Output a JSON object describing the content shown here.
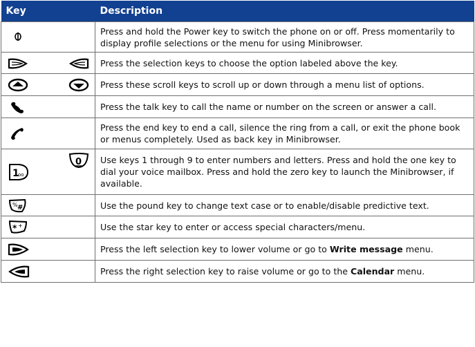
{
  "table": {
    "headers": {
      "key": "Key",
      "description": "Description"
    },
    "rows": [
      {
        "icons": [
          "power-key-icon"
        ],
        "segments": [
          {
            "text": "Press and hold the Power key to switch the phone on or off. Press momentarily to display profile selections or the menu for using Minibrowser."
          }
        ]
      },
      {
        "icons": [
          "left-selection-key-icon",
          "right-selection-key-icon"
        ],
        "segments": [
          {
            "text": "Press the selection keys to choose the option labeled above the key."
          }
        ]
      },
      {
        "icons": [
          "scroll-up-key-icon",
          "scroll-down-key-icon"
        ],
        "segments": [
          {
            "text": "Press these scroll keys to scroll up or down through a menu list of options."
          }
        ]
      },
      {
        "icons": [
          "talk-key-icon"
        ],
        "segments": [
          {
            "text": "Press the talk key to call the name or number on the screen or answer a call."
          }
        ]
      },
      {
        "icons": [
          "end-key-icon"
        ],
        "segments": [
          {
            "text": "Press the end key to end a call, silence the ring from a call, or exit the phone book or menus completely. Used as back key in Minibrowser."
          }
        ]
      },
      {
        "icons": [
          "one-key-icon",
          "zero-key-icon"
        ],
        "segments": [
          {
            "text": "Use keys 1 through 9 to enter numbers and letters. Press and hold the one key to dial your voice mailbox. Press and hold the zero key to launch the Minibrowser, if available."
          }
        ]
      },
      {
        "icons": [
          "pound-key-icon"
        ],
        "segments": [
          {
            "text": "Use the pound key to change text case or to enable/disable predictive text."
          }
        ]
      },
      {
        "icons": [
          "star-key-icon"
        ],
        "segments": [
          {
            "text": "Use the star key to enter or access special characters/menu."
          }
        ]
      },
      {
        "icons": [
          "left-selection-key-icon"
        ],
        "segments": [
          {
            "text": "Press the left selection key to lower volume or go to "
          },
          {
            "text": "Write message",
            "bold": true
          },
          {
            "text": " menu."
          }
        ]
      },
      {
        "icons": [
          "right-selection-key-icon"
        ],
        "segments": [
          {
            "text": "Press the right selection key to raise volume or go to the "
          },
          {
            "text": "Calendar",
            "bold": true
          },
          {
            "text": " menu."
          }
        ]
      }
    ]
  }
}
